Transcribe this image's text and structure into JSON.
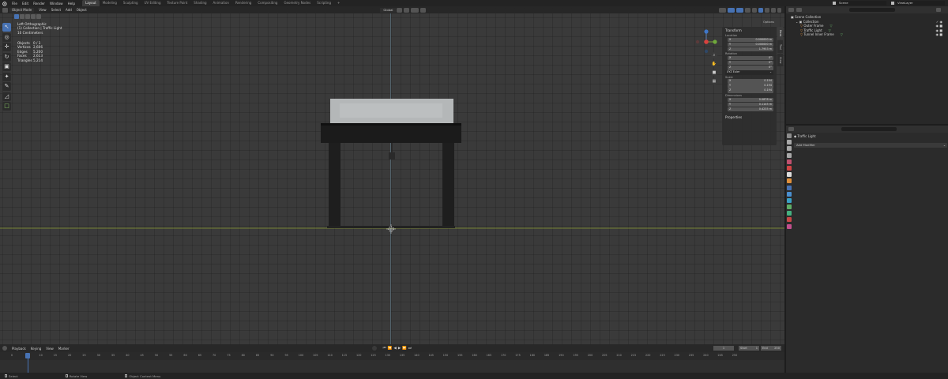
{
  "topbar": {
    "menus": [
      "File",
      "Edit",
      "Render",
      "Window",
      "Help"
    ],
    "workspaces": [
      "Layout",
      "Modeling",
      "Sculpting",
      "UV Editing",
      "Texture Paint",
      "Shading",
      "Animation",
      "Rendering",
      "Compositing",
      "Geometry Nodes",
      "Scripting"
    ],
    "active_workspace": "Layout",
    "scene": "Scene",
    "view_layer": "ViewLayer"
  },
  "viewport": {
    "mode": "Object Mode",
    "menus": [
      "View",
      "Select",
      "Add",
      "Object"
    ],
    "transform_orientation": "Global",
    "options_label": "Options",
    "overlay_view": "Left Orthographic",
    "overlay_collection": "(1) Collection | Traffic Light",
    "overlay_units": "10 Centimeters",
    "stats": [
      {
        "key": "Objects",
        "value": "0 / 3"
      },
      {
        "key": "Vertices",
        "value": "2,606"
      },
      {
        "key": "Edges",
        "value": "5,200"
      },
      {
        "key": "Faces",
        "value": "2,613"
      },
      {
        "key": "Triangles",
        "value": "5,214"
      }
    ],
    "npanel": {
      "transform_title": "Transform",
      "location_label": "Location",
      "location": {
        "x": "0.000000 m",
        "y": "0.000000 m",
        "z": "1.7953 m"
      },
      "rotation_label": "Rotation",
      "rotation": {
        "x": "0°",
        "y": "0°",
        "z": "0°"
      },
      "rotation_mode": "XYZ Euler",
      "scale_label": "Scale",
      "scale": {
        "x": "0.194",
        "y": "0.194",
        "z": "0.194"
      },
      "dimensions_label": "Dimensions",
      "dimensions": {
        "x": "0.0878 m",
        "y": "0.1145 m",
        "z": "0.4235 m"
      },
      "properties_title": "Properties",
      "tabs": [
        "Item",
        "Tool",
        "View"
      ]
    }
  },
  "timeline": {
    "menus": [
      "Playback",
      "Keying",
      "View",
      "Marker"
    ],
    "current_frame": "1",
    "start_label": "Start",
    "start": "1",
    "end_label": "End",
    "end": "250",
    "ruler_ticks": [
      "0",
      "5",
      "10",
      "15",
      "20",
      "25",
      "30",
      "35",
      "40",
      "45",
      "50",
      "55",
      "60",
      "65",
      "70",
      "75",
      "80",
      "85",
      "90",
      "95",
      "100",
      "105",
      "110",
      "115",
      "120",
      "125",
      "130",
      "135",
      "140",
      "145",
      "150",
      "155",
      "160",
      "165",
      "170",
      "175",
      "180",
      "185",
      "190",
      "195",
      "200",
      "205",
      "210",
      "215",
      "220",
      "225",
      "230",
      "235",
      "240",
      "245",
      "250"
    ]
  },
  "statusbar": {
    "select": "Select",
    "rotate": "Rotate View",
    "context": "Object Context Menu"
  },
  "outliner": {
    "root": "Scene Collection",
    "collection": "Collection",
    "items": [
      "Outer Frame",
      "Traffic Light",
      "Tunnel Inner Frame"
    ]
  },
  "properties": {
    "object_name": "Traffic Light",
    "add_modifier": "Add Modifier"
  },
  "colors": {
    "accent": "#4772b3",
    "grid_bg": "#3a3a3a",
    "ground_line": "#8a9a33",
    "vertical_axis": "#5a6e7a"
  }
}
